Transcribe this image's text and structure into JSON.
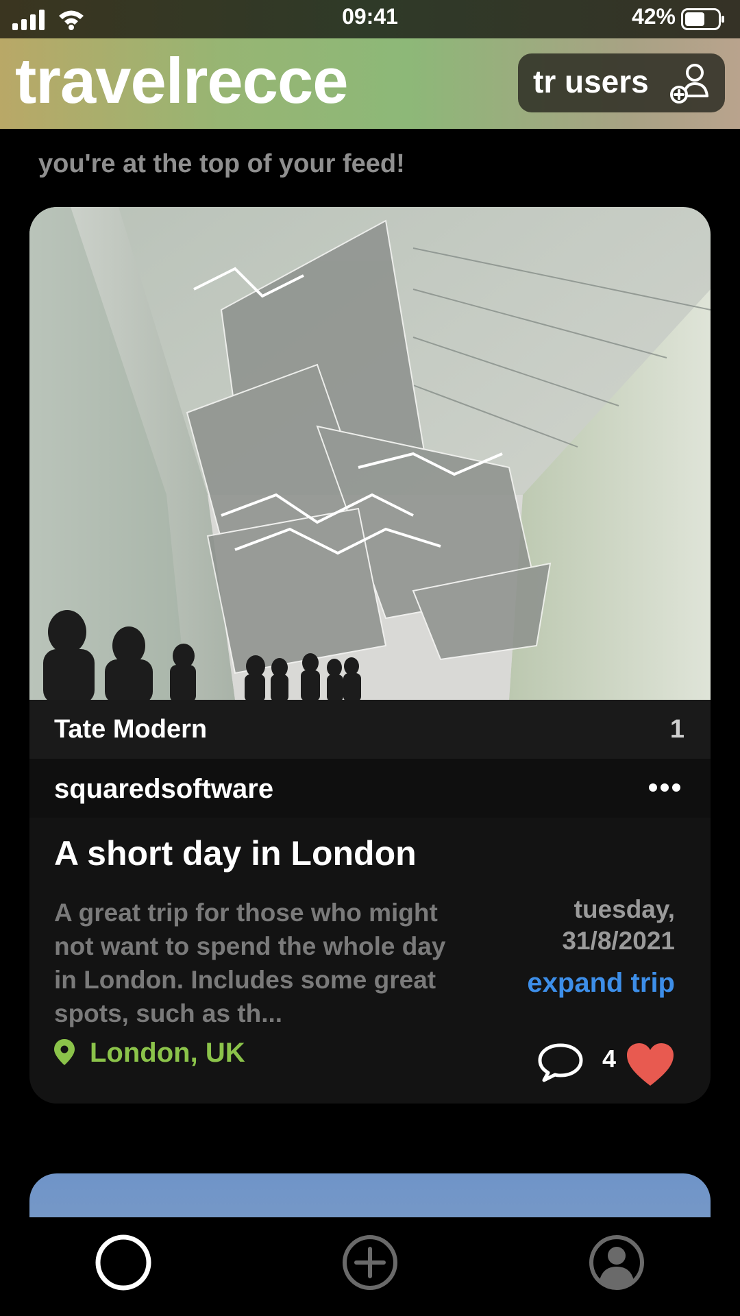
{
  "status_bar": {
    "time": "09:41",
    "battery_percent": "42%",
    "icons": [
      "cellular-signal-icon",
      "wifi-icon",
      "battery-icon"
    ]
  },
  "header": {
    "title": "travelrecce",
    "users_button_label": "tr users",
    "users_icon": "add-user-icon"
  },
  "feed": {
    "top_message": "you're at the top of your feed!",
    "post": {
      "image": "photo of a suspended glass-and-neon installation in a gallery hall",
      "place_name": "Tate Modern",
      "place_number": "1",
      "author": "squaredsoftware",
      "title": "A short day in London",
      "description": "A great trip for those who might not want to spend the whole day in London.  Includes some great spots, such as th...",
      "date_day": "tuesday,",
      "date": "31/8/2021",
      "expand_label": "expand trip",
      "location": "London, UK",
      "likes": "4"
    }
  },
  "colors": {
    "accent_link": "#3d8ee8",
    "location": "#8bc34a",
    "like_heart": "#e85a50"
  },
  "tab_bar": {
    "tabs": [
      "home",
      "add",
      "profile"
    ]
  }
}
